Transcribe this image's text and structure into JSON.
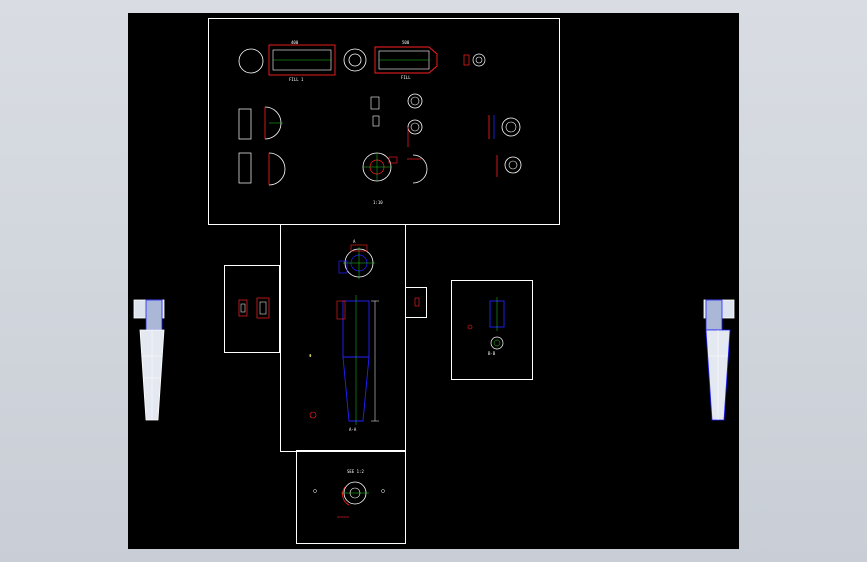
{
  "labels": {
    "fill_left": "FILL 1",
    "fill_right": "FILL",
    "dim_left": "400",
    "dim_right": "500",
    "sec_a": "A-A",
    "sec_b": "B-B",
    "phi": "Φ",
    "scale": "1:10",
    "blow": "SEE 1:2",
    "view_a": "A"
  },
  "colors": {
    "canvas": "#000000",
    "frame": "#ffffff",
    "geometry": "#ffffff",
    "highlight": "#ff2020",
    "section": "#2222ff",
    "center": "#22cc22",
    "annotation": "#ffff66"
  }
}
